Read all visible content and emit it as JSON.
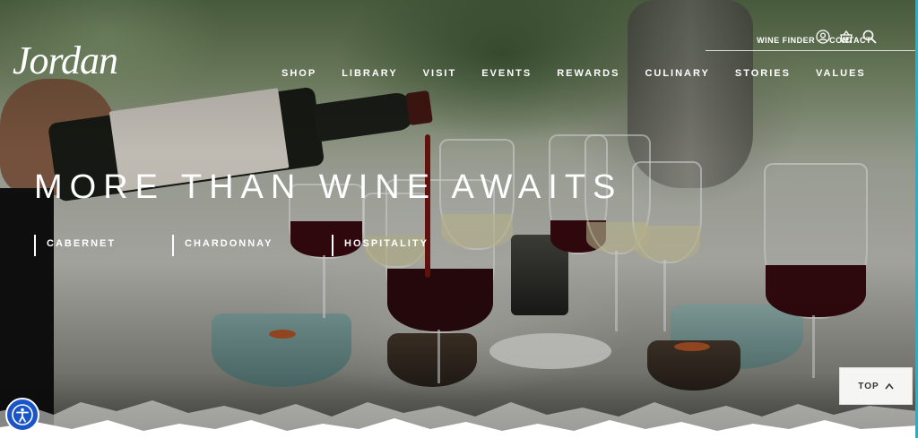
{
  "brand": {
    "logo_text": "Jordan"
  },
  "utility_nav": {
    "wine_finder": "WINE FINDER",
    "contact": "CONTACT"
  },
  "icons": {
    "account": "user-icon",
    "cart": "basket-icon",
    "search": "search-icon"
  },
  "main_nav": [
    "SHOP",
    "LIBRARY",
    "VISIT",
    "EVENTS",
    "REWARDS",
    "CULINARY",
    "STORIES",
    "VALUES"
  ],
  "hero": {
    "headline": "MORE THAN WINE AWAITS",
    "links": [
      "CABERNET",
      "CHARDONNAY",
      "HOSPITALITY"
    ]
  },
  "back_to_top": {
    "label": "TOP"
  },
  "colors": {
    "accent": "#1a55c8",
    "text": "#ffffff",
    "wine": "#5b0d12"
  }
}
